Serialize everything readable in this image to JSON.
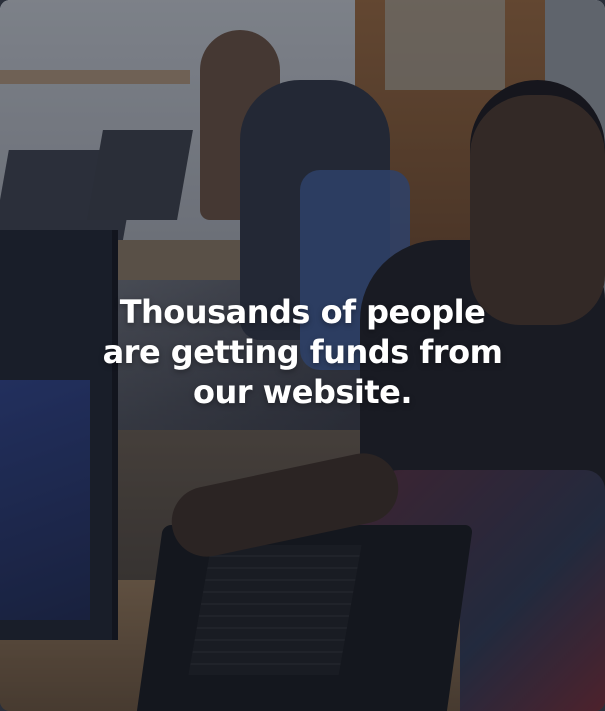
{
  "hero": {
    "headline": "Thousands of people\nare getting funds from\nour website."
  },
  "colors": {
    "overlay": "#181c28",
    "text": "#ffffff"
  }
}
